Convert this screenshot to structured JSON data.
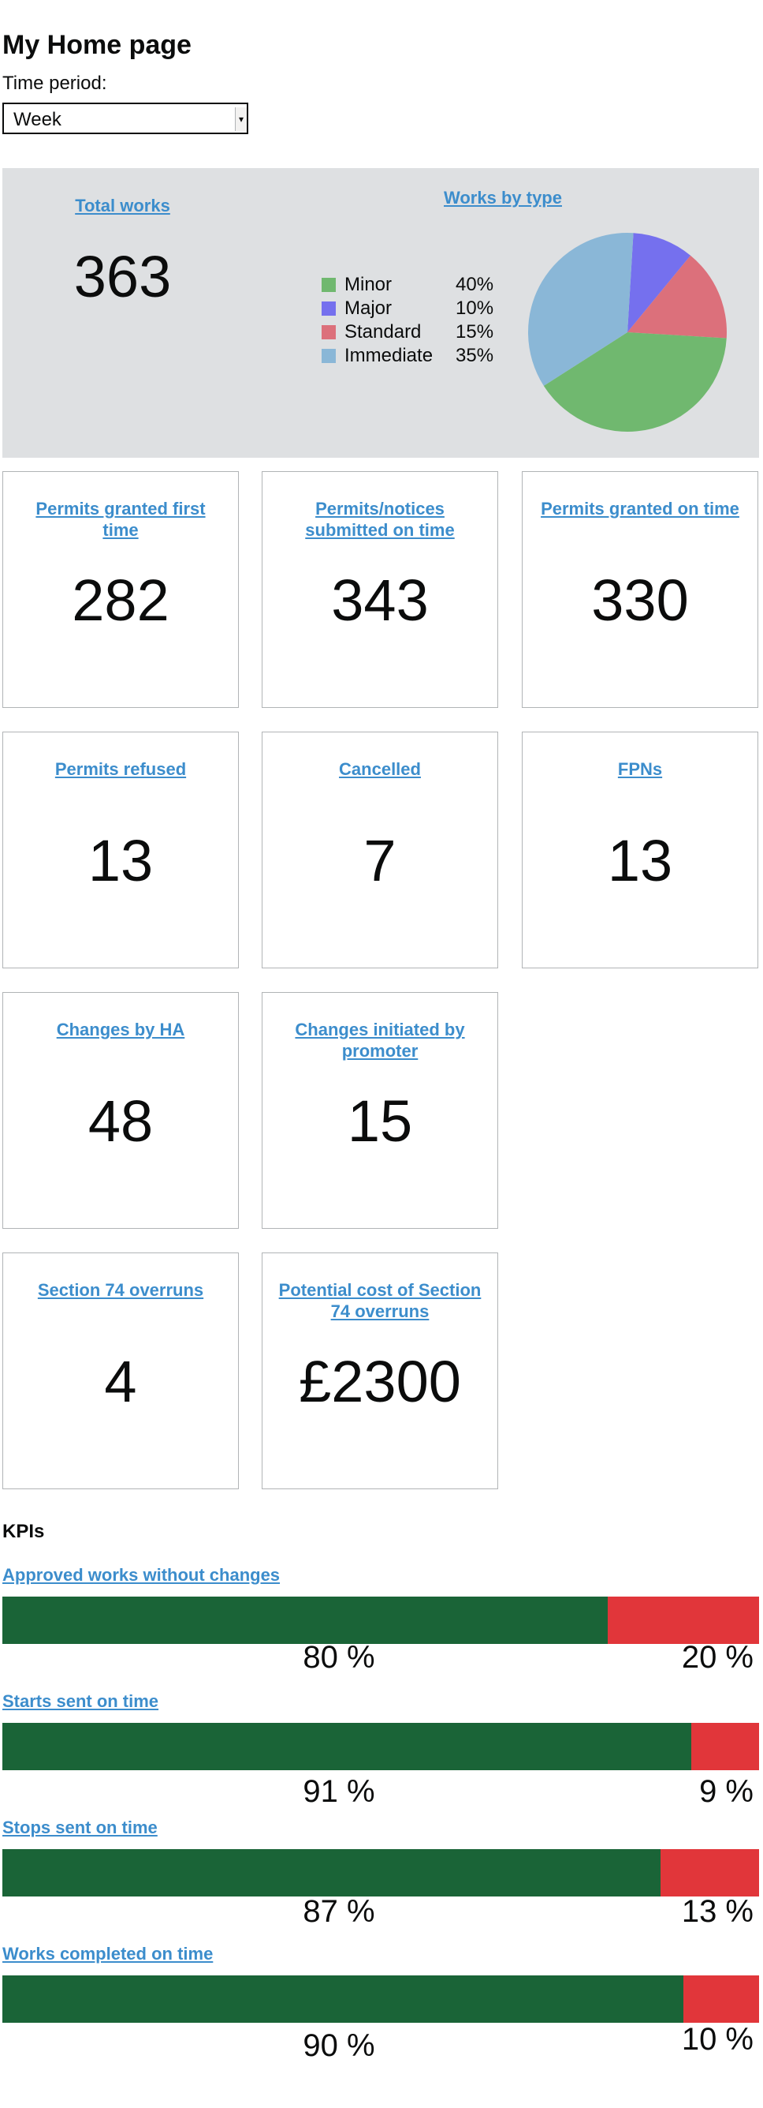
{
  "header": {
    "title": "My Home page"
  },
  "time_period": {
    "label": "Time period:",
    "selected": "Week"
  },
  "summary": {
    "total_works": {
      "label": "Total works",
      "value": "363"
    },
    "works_by_type": {
      "label": "Works by type",
      "items": [
        {
          "name": "Minor",
          "pct": "40%",
          "value": 40,
          "color": "#70b86f"
        },
        {
          "name": "Major",
          "pct": "10%",
          "value": 10,
          "color": "#7570ee"
        },
        {
          "name": "Standard",
          "pct": "15%",
          "value": 15,
          "color": "#dc707b"
        },
        {
          "name": "Immediate",
          "pct": "35%",
          "value": 35,
          "color": "#8ab7d7"
        }
      ]
    }
  },
  "cards": [
    {
      "label": "Permits granted first time",
      "value": "282"
    },
    {
      "label": "Permits/notices submitted on time",
      "value": "343"
    },
    {
      "label": "Permits granted on time",
      "value": "330"
    },
    {
      "label": "Permits refused",
      "value": "13"
    },
    {
      "label": "Cancelled",
      "value": "7"
    },
    {
      "label": "FPNs",
      "value": "13"
    },
    {
      "label": "Changes by HA",
      "value": "48"
    },
    {
      "label": "Changes initiated by promoter",
      "value": "15"
    },
    {
      "label": "Section 74 overruns",
      "value": "4"
    },
    {
      "label": "Potential cost of Section 74 overruns",
      "value": "£2300"
    }
  ],
  "kpis": {
    "heading": "KPIs",
    "items": [
      {
        "label": "Approved works without changes",
        "good": 80,
        "bad": 20,
        "good_text": "80 %",
        "bad_text": "20 %"
      },
      {
        "label": "Starts sent on time",
        "good": 91,
        "bad": 9,
        "good_text": "91 %",
        "bad_text": "9 %"
      },
      {
        "label": "Stops sent on time",
        "good": 87,
        "bad": 13,
        "good_text": "87 %",
        "bad_text": "13 %"
      },
      {
        "label": "Works completed on time",
        "good": 90,
        "bad": 10,
        "good_text": "90 %",
        "bad_text": "10 %"
      }
    ]
  },
  "colors": {
    "link": "#3c8dcc",
    "summary_bg": "#dee0e2",
    "kpi_good": "#1a6437",
    "kpi_bad": "#e1363a"
  }
}
